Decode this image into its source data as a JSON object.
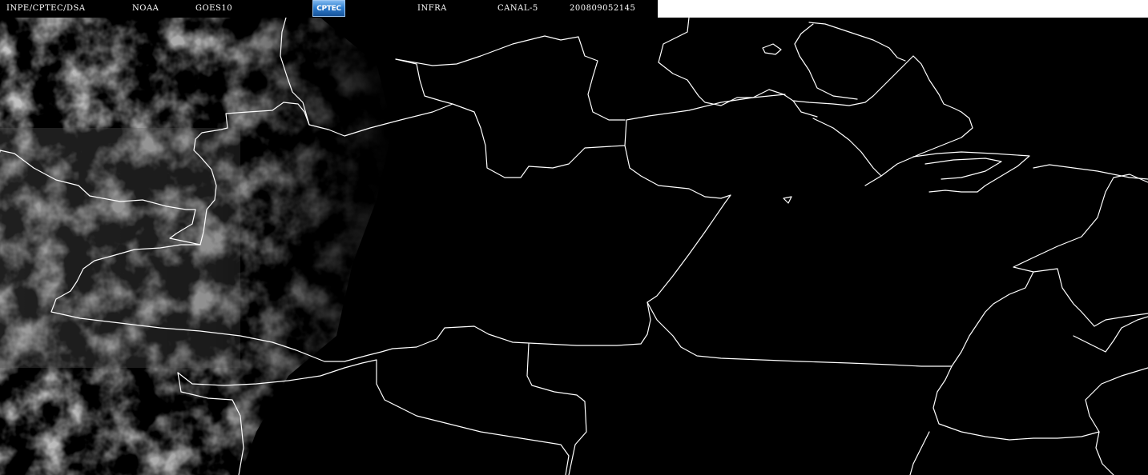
{
  "header": {
    "source": "INPE/CPTEC/DSA",
    "agency": "NOAA",
    "satellite": "GOES10",
    "logo": "CPTEC",
    "band": "INFRA",
    "channel": "CANAL-5",
    "timestamp": "200809052145"
  },
  "colors": {
    "background": "#000000",
    "borders": "#ffffff",
    "header_text": "#ffffff",
    "header_blank": "#ffffff",
    "clouds": "#8a8a8a",
    "logo_blue": "#2f7fd0"
  },
  "map": {
    "type": "satellite-infrared-image",
    "boundary_lines": "white",
    "cloud_cover_region": "west"
  }
}
